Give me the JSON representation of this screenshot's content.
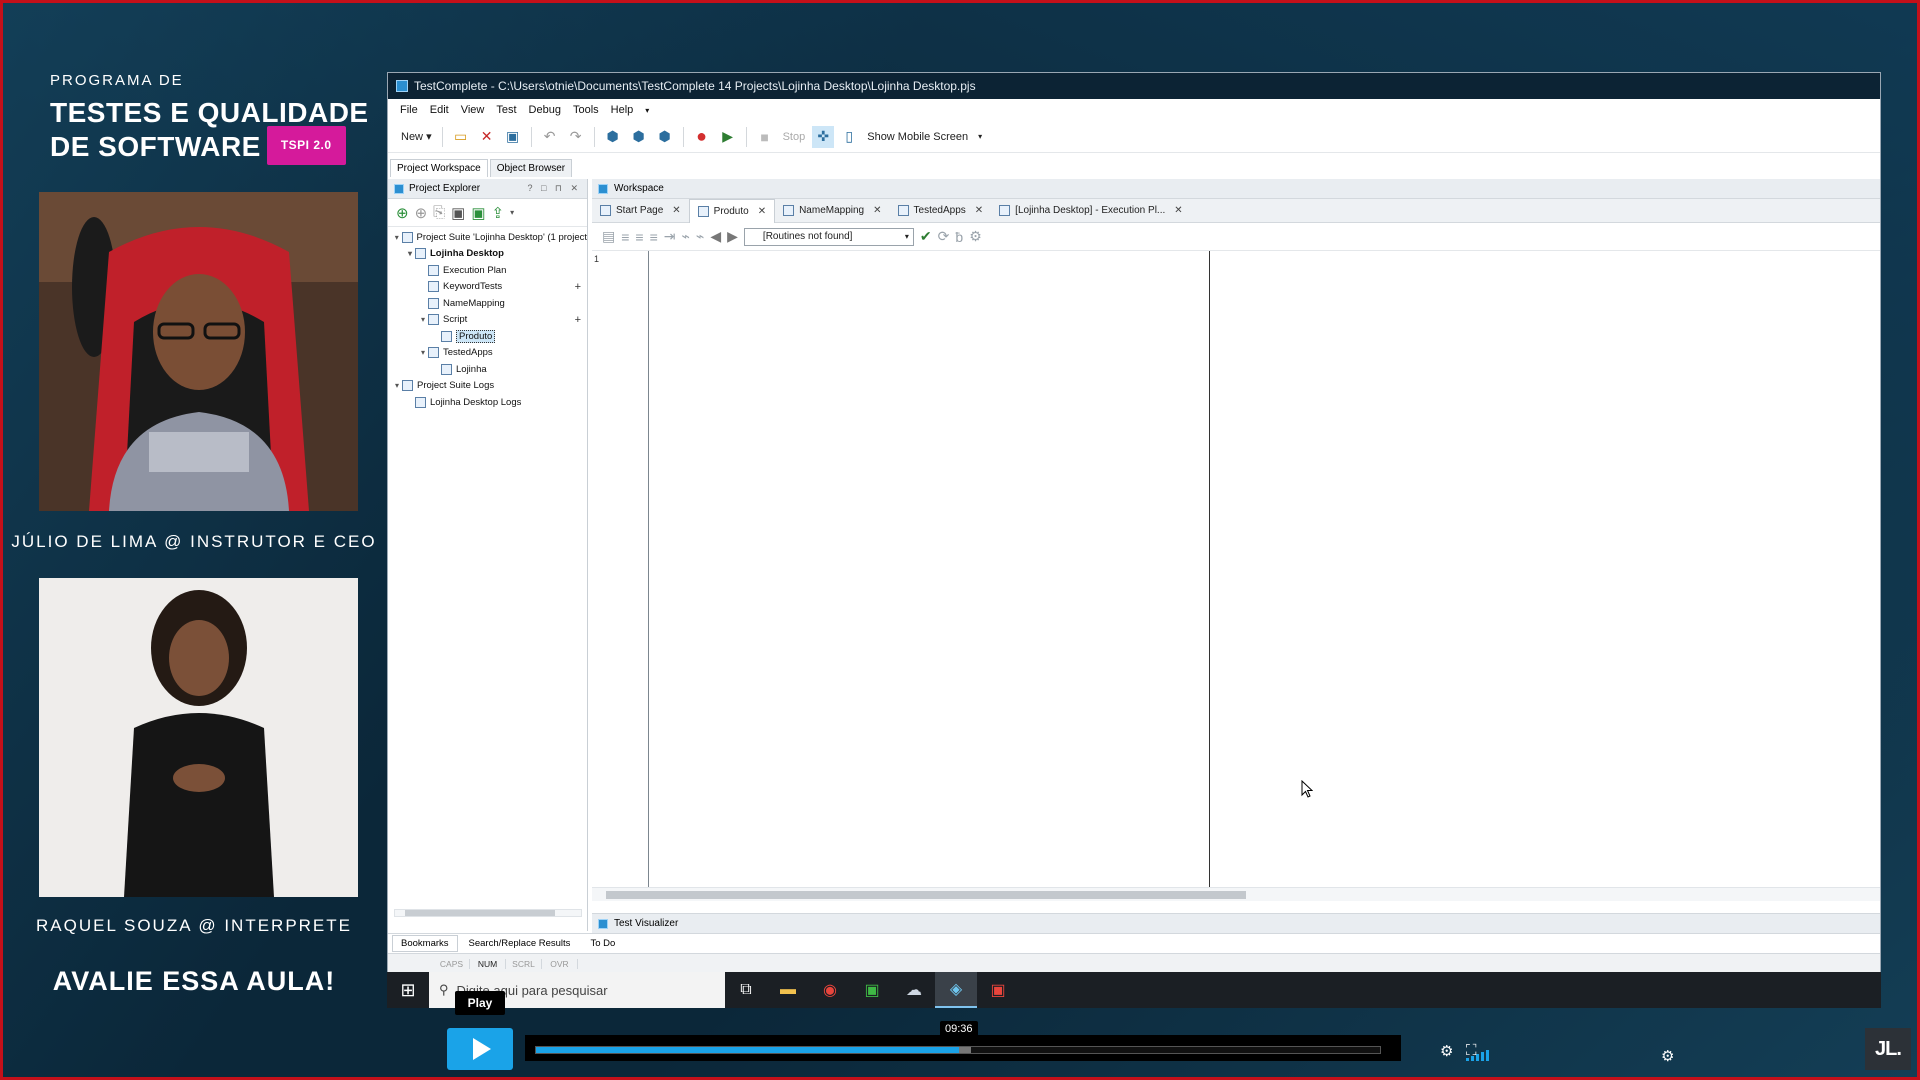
{
  "program": {
    "pre_title": "PROGRAMA DE",
    "title_line1": "TESTES E QUALIDADE",
    "title_line2": "DE SOFTWARE",
    "badge": "TSPI 2.0",
    "instructor_caption": "JÚLIO DE LIMA @ INSTRUTOR E CEO",
    "interpreter_caption": "RAQUEL SOUZA @ INTERPRETE",
    "cta": "AVALIE ESSA AULA!",
    "accent_color": "#d51a9b",
    "border_color": "#c4101a"
  },
  "window": {
    "title": "TestComplete - C:\\Users\\otnie\\Documents\\TestComplete 14 Projects\\Lojinha Desktop\\Lojinha Desktop.pjs"
  },
  "menu": [
    "File",
    "Edit",
    "View",
    "Test",
    "Debug",
    "Tools",
    "Help"
  ],
  "toolbar": {
    "new_label": "New",
    "stop_label": "Stop",
    "mobile_label": "Show Mobile Screen"
  },
  "panels": {
    "project_workspace": "Project Workspace",
    "object_browser": "Object Browser",
    "project_explorer": "Project Explorer",
    "workspace": "Workspace",
    "test_visualizer": "Test Visualizer"
  },
  "tree": [
    {
      "label": "Project Suite 'Lojinha Desktop' (1 project",
      "level": 0,
      "toggle": "v",
      "bold": false
    },
    {
      "label": "Lojinha Desktop",
      "level": 1,
      "toggle": "v",
      "bold": true
    },
    {
      "label": "Execution Plan",
      "level": 2,
      "toggle": "",
      "bold": false
    },
    {
      "label": "KeywordTests",
      "level": 2,
      "toggle": "",
      "bold": false,
      "plus": true
    },
    {
      "label": "NameMapping",
      "level": 2,
      "toggle": "",
      "bold": false
    },
    {
      "label": "Script",
      "level": 2,
      "toggle": "v",
      "bold": false,
      "plus": true
    },
    {
      "label": "Produto",
      "level": 3,
      "toggle": "",
      "bold": false,
      "selected": true
    },
    {
      "label": "TestedApps",
      "level": 2,
      "toggle": "v",
      "bold": false
    },
    {
      "label": "Lojinha",
      "level": 3,
      "toggle": "",
      "bold": false
    },
    {
      "label": "Project Suite Logs",
      "level": 0,
      "toggle": "v",
      "bold": false
    },
    {
      "label": "Lojinha Desktop Logs",
      "level": 1,
      "toggle": "",
      "bold": false
    }
  ],
  "doc_tabs": [
    {
      "label": "Start Page",
      "active": false
    },
    {
      "label": "Produto",
      "active": true
    },
    {
      "label": "NameMapping",
      "active": false
    },
    {
      "label": "TestedApps",
      "active": false
    },
    {
      "label": "[Lojinha Desktop] - Execution Pl...",
      "active": false
    }
  ],
  "editor": {
    "routines_dropdown": "[Routines not found]",
    "line_number": "1"
  },
  "bottom_tabs": [
    "Bookmarks",
    "Search/Replace Results",
    "To Do"
  ],
  "status_indicators": [
    {
      "label": "CAPS",
      "on": false
    },
    {
      "label": "NUM",
      "on": true
    },
    {
      "label": "SCRL",
      "on": false
    },
    {
      "label": "OVR",
      "on": false
    }
  ],
  "taskbar": {
    "search_placeholder": "Digite aqui para pesquisar"
  },
  "player": {
    "play_tooltip": "Play",
    "time": "09:36",
    "progress": 0.5,
    "brand": "JL.",
    "accent_color": "#1aa3e8"
  }
}
